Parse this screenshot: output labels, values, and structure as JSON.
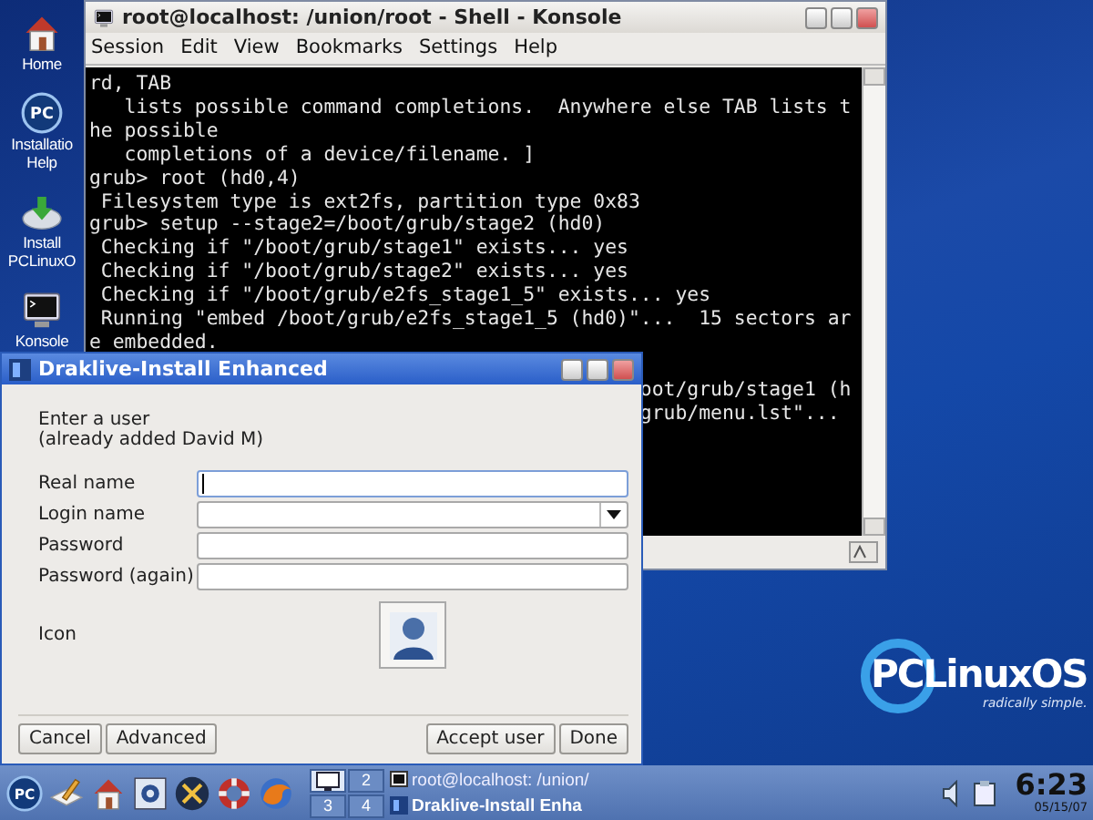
{
  "desktop_icons": [
    {
      "kind": "home",
      "label_lines": [
        "Home"
      ]
    },
    {
      "kind": "pc",
      "badge": "PC",
      "label_lines": [
        "Installatio",
        "Help"
      ]
    },
    {
      "kind": "install",
      "label_lines": [
        "Install",
        "PCLinuxO"
      ]
    },
    {
      "kind": "terminal",
      "label_lines": [
        "Konsole"
      ]
    }
  ],
  "konsole": {
    "title": "root@localhost: /union/root - Shell - Konsole",
    "menu": [
      "Session",
      "Edit",
      "View",
      "Bookmarks",
      "Settings",
      "Help"
    ],
    "lines": [
      "rd, TAB",
      "   lists possible command completions.  Anywhere else TAB lists t",
      "he possible",
      "   completions of a device/filename. ]",
      "grub> root (hd0,4)",
      " Filesystem type is ext2fs, partition type 0x83",
      "grub> setup --stage2=/boot/grub/stage2 (hd0)",
      " Checking if \"/boot/grub/stage1\" exists... yes",
      " Checking if \"/boot/grub/stage2\" exists... yes",
      " Checking if \"/boot/grub/e2fs_stage1_5\" exists... yes",
      " Running \"embed /boot/grub/e2fs_stage1_5 (hd0)\"...  15 sectors ar",
      "e embedded."
    ],
    "partial_lines": [
      "oot/grub/stage1 (h",
      "grub/menu.lst\"..."
    ]
  },
  "dialog": {
    "title": "Draklive-Install Enhanced",
    "intro": [
      "Enter a user",
      "(already added David M)"
    ],
    "fields": [
      {
        "label": "Real name",
        "kind": "text",
        "focused": true
      },
      {
        "label": "Login name",
        "kind": "combo",
        "focused": false
      },
      {
        "label": "Password",
        "kind": "text",
        "focused": false
      },
      {
        "label": "Password (again)",
        "kind": "text",
        "focused": false
      }
    ],
    "icon_label": "Icon",
    "buttons_left": [
      "Cancel",
      "Advanced"
    ],
    "buttons_right": [
      "Accept user",
      "Done"
    ]
  },
  "logo": {
    "name": "PCLinuxOS",
    "tagline": "radically simple."
  },
  "taskbar": {
    "launchers": [
      {
        "kind": "pc",
        "badge": "PC"
      },
      {
        "kind": "pencil"
      },
      {
        "kind": "home"
      },
      {
        "kind": "control"
      },
      {
        "kind": "tools"
      },
      {
        "kind": "lifebuoy"
      },
      {
        "kind": "browser"
      }
    ],
    "pager": [
      {
        "kind": "icon",
        "selected": true
      },
      {
        "kind": "number",
        "label": "2",
        "selected": false
      },
      {
        "kind": "number",
        "label": "3",
        "selected": false
      },
      {
        "kind": "number",
        "label": "4",
        "selected": false
      }
    ],
    "tasks": [
      {
        "kind": "terminal",
        "title": "root@localhost: /union/",
        "selected": false
      },
      {
        "kind": "dialog",
        "title": "Draklive-Install Enha",
        "selected": true
      }
    ],
    "tray": [
      {
        "kind": "speaker"
      },
      {
        "kind": "clipboard"
      }
    ],
    "clock": {
      "time": "6:23",
      "date": "05/15/07"
    }
  }
}
